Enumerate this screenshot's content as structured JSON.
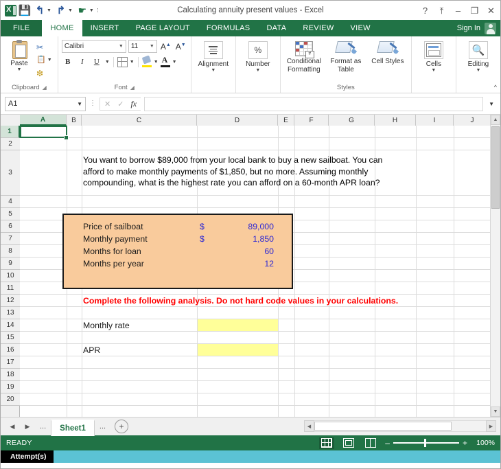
{
  "window": {
    "title": "Calculating annuity present values - Excel",
    "quick_access": [
      "save-icon",
      "undo-icon",
      "redo-icon",
      "touch-mode-icon",
      "customize-icon"
    ],
    "buttons": {
      "help": "?",
      "ribbon_display": "⤒",
      "minimize": "–",
      "restore": "❐",
      "close": "✕"
    }
  },
  "ribbon": {
    "tabs": [
      {
        "label": "FILE",
        "active": false,
        "is_file": true
      },
      {
        "label": "HOME",
        "active": true,
        "is_file": false
      },
      {
        "label": "INSERT",
        "active": false,
        "is_file": false
      },
      {
        "label": "PAGE LAYOUT",
        "active": false,
        "is_file": false
      },
      {
        "label": "FORMULAS",
        "active": false,
        "is_file": false
      },
      {
        "label": "DATA",
        "active": false,
        "is_file": false
      },
      {
        "label": "REVIEW",
        "active": false,
        "is_file": false
      },
      {
        "label": "VIEW",
        "active": false,
        "is_file": false
      }
    ],
    "sign_in": "Sign In",
    "groups": {
      "clipboard": {
        "label": "Clipboard",
        "paste": "Paste",
        "cut": "cut-icon",
        "copy": "copy-icon",
        "format_painter": "format-painter-icon"
      },
      "font": {
        "label": "Font",
        "font_name": "Calibri",
        "font_size": "11",
        "grow_font": "A",
        "shrink_font": "A",
        "bold": "B",
        "italic": "I",
        "underline": "U",
        "borders": "borders-icon",
        "fill_color": "fill-color-icon",
        "font_color": "font-color-icon"
      },
      "alignment": {
        "label": "Alignment"
      },
      "number": {
        "label": "Number",
        "symbol": "%"
      },
      "styles": {
        "label": "Styles",
        "conditional_formatting": "Conditional Formatting",
        "format_as_table": "Format as Table",
        "cell_styles": "Cell Styles"
      },
      "cells": {
        "label": "Cells"
      },
      "editing": {
        "label": "Editing"
      }
    }
  },
  "formula_bar": {
    "name_box": "A1",
    "cancel": "✕",
    "enter": "✓",
    "insert_function": "fx",
    "formula_value": ""
  },
  "grid": {
    "columns": [
      "A",
      "B",
      "C",
      "D",
      "E",
      "F",
      "G",
      "H",
      "I",
      "J"
    ],
    "rows": [
      "1",
      "2",
      "3",
      "4",
      "5",
      "6",
      "7",
      "8",
      "9",
      "10",
      "11",
      "12",
      "13",
      "14",
      "15",
      "16",
      "17",
      "18",
      "19",
      "20"
    ],
    "selected_cell": "A1",
    "selected_column": "A",
    "selected_row": "1",
    "problem_text": "You want to borrow $89,000 from your local bank to buy a new sailboat. You can\nafford to make monthly payments of $1,850, but no more. Assuming monthly\ncompounding, what is the highest rate you can afford on a 60-month APR loan?",
    "input_box": {
      "fill_color": "#f9cb9c",
      "border_color": "#1a1a1a",
      "rows": [
        {
          "label": "Price of sailboat",
          "currency": "$",
          "value": "89,000"
        },
        {
          "label": "Monthly payment",
          "currency": "$",
          "value": "1,850"
        },
        {
          "label": "Months for loan",
          "currency": "",
          "value": "60"
        },
        {
          "label": "Months per year",
          "currency": "",
          "value": "12"
        }
      ]
    },
    "instruction": "Complete the following analysis. Do not hard code values in your calculations.",
    "instruction_color": "#ff0000",
    "answers": [
      {
        "label": "Monthly rate",
        "value": "",
        "fill_color": "#ffff99"
      },
      {
        "label": "APR",
        "value": "",
        "fill_color": "#ffff99"
      }
    ]
  },
  "sheet_tabs": {
    "first": "◀",
    "prev": "▶",
    "left_ellipsis": "...",
    "tabs": [
      {
        "label": "Sheet1",
        "active": true
      }
    ],
    "right_ellipsis": "...",
    "new_sheet": "+"
  },
  "status_bar": {
    "mode": "READY",
    "views": [
      {
        "name": "normal-view",
        "active": true
      },
      {
        "name": "page-layout-view",
        "active": false
      },
      {
        "name": "page-break-preview",
        "active": false
      }
    ],
    "zoom_out": "–",
    "zoom_in": "+",
    "zoom_level": "100%"
  },
  "overlay": {
    "attempts_label": "Attempt(s)"
  }
}
